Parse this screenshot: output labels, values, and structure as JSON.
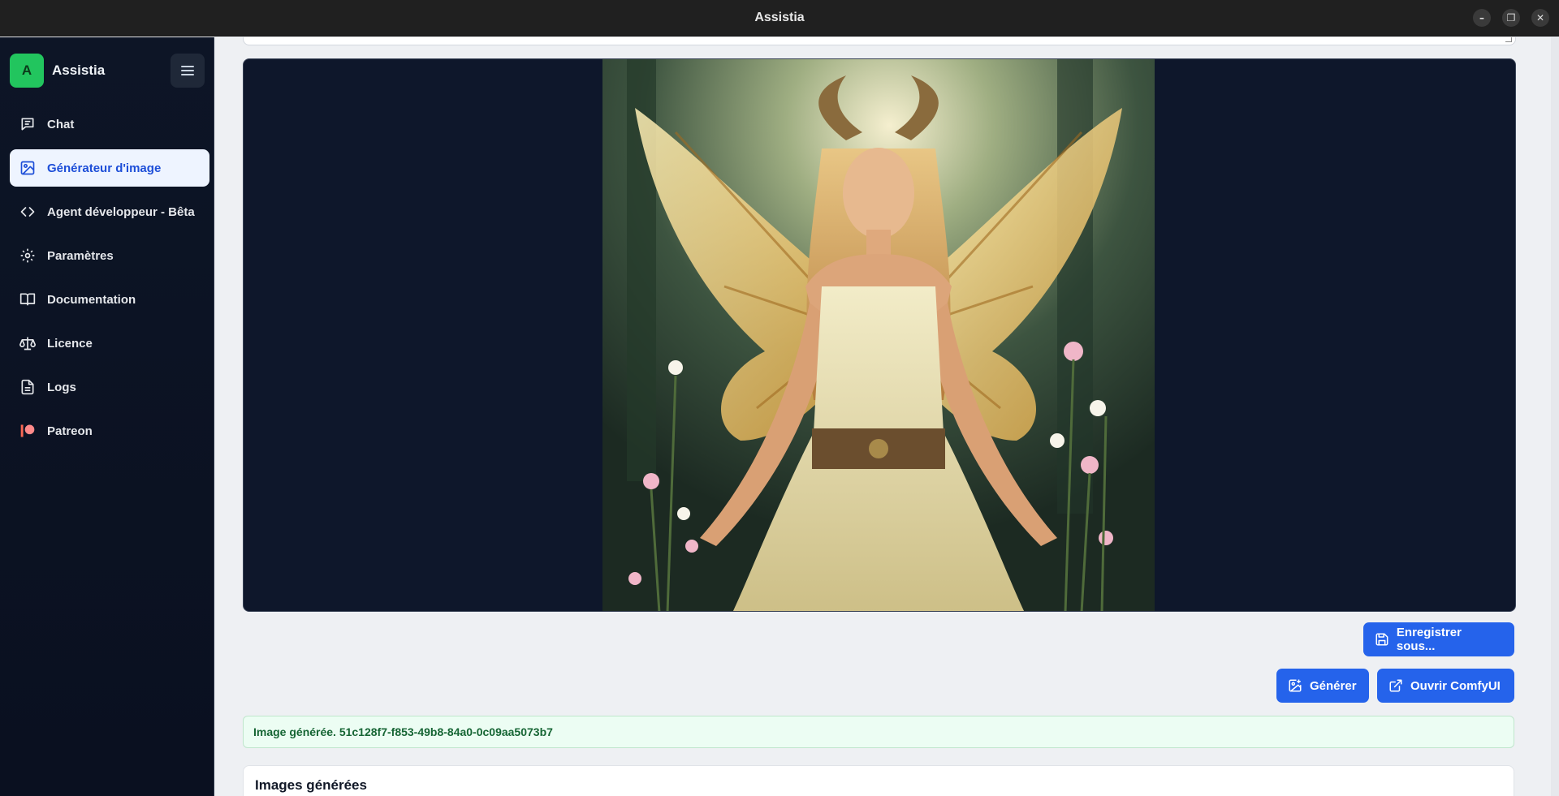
{
  "window": {
    "title": "Assistia",
    "controls": [
      "minimize",
      "restore",
      "close"
    ]
  },
  "sidebar": {
    "brand_initial": "A",
    "brand_name": "Assistia",
    "items": [
      {
        "label": "Chat",
        "icon": "chat-icon",
        "active": false
      },
      {
        "label": "Générateur d'image",
        "icon": "image-icon",
        "active": true
      },
      {
        "label": "Agent développeur - Bêta",
        "icon": "code-icon",
        "active": false
      },
      {
        "label": "Paramètres",
        "icon": "gear-icon",
        "active": false
      },
      {
        "label": "Documentation",
        "icon": "book-icon",
        "active": false
      },
      {
        "label": "Licence",
        "icon": "scale-icon",
        "active": false
      },
      {
        "label": "Logs",
        "icon": "file-text-icon",
        "active": false
      },
      {
        "label": "Patreon",
        "icon": "patreon-icon",
        "active": false
      }
    ]
  },
  "main": {
    "buttons": {
      "save": "Enregistrer sous...",
      "generate": "Générer",
      "open_comfy": "Ouvrir ComfyUI"
    },
    "status": "Image générée. 51c128f7-f853-49b8-84a0-0c09aa5073b7",
    "gallery_title": "Images générées"
  },
  "colors": {
    "accent": "#2563eb",
    "sidebar_bg": "#0d1526",
    "brand_green": "#22c55e",
    "status_green": "#166534",
    "patreon": "#f96854"
  }
}
